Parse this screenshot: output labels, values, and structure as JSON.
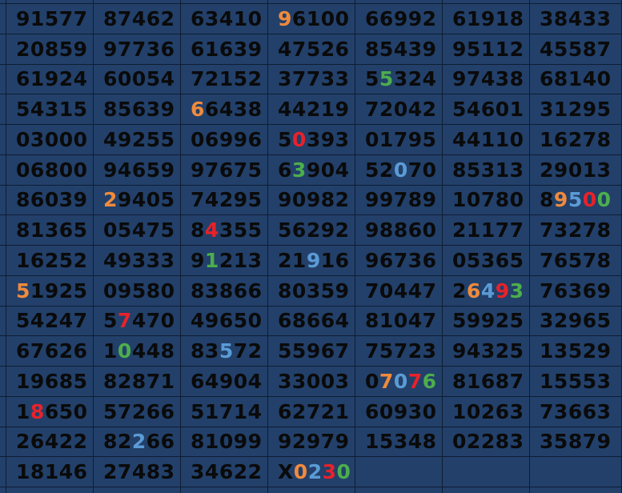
{
  "colors": {
    "background": "#22406a",
    "grid_line": "#0f1d33",
    "text": "#0a0a0a",
    "orange": "#f08a3c",
    "green": "#4cae4c",
    "red": "#e8222a",
    "blue": "#5b9bd5"
  },
  "rows": [
    [
      {
        "text": "91577"
      },
      {
        "text": "87462"
      },
      {
        "text": "63410"
      },
      {
        "text": "96100",
        "hl": {
          "0": "orange"
        }
      },
      {
        "text": "66992"
      },
      {
        "text": "61918"
      },
      {
        "text": "38433"
      }
    ],
    [
      {
        "text": "20859"
      },
      {
        "text": "97736"
      },
      {
        "text": "61639"
      },
      {
        "text": "47526"
      },
      {
        "text": "85439"
      },
      {
        "text": "95112"
      },
      {
        "text": "45587"
      }
    ],
    [
      {
        "text": "61924"
      },
      {
        "text": "60054"
      },
      {
        "text": "72152"
      },
      {
        "text": "37733"
      },
      {
        "text": "55324",
        "hl": {
          "1": "green"
        }
      },
      {
        "text": "97438"
      },
      {
        "text": "68140"
      }
    ],
    [
      {
        "text": "54315"
      },
      {
        "text": "85639"
      },
      {
        "text": "66438",
        "hl": {
          "0": "orange"
        }
      },
      {
        "text": "44219"
      },
      {
        "text": "72042"
      },
      {
        "text": "54601"
      },
      {
        "text": "31295"
      }
    ],
    [
      {
        "text": "03000"
      },
      {
        "text": "49255"
      },
      {
        "text": "06996"
      },
      {
        "text": "50393",
        "hl": {
          "1": "red"
        }
      },
      {
        "text": "01795"
      },
      {
        "text": "44110"
      },
      {
        "text": "16278"
      }
    ],
    [
      {
        "text": "06800"
      },
      {
        "text": "94659"
      },
      {
        "text": "97675"
      },
      {
        "text": "63904",
        "hl": {
          "1": "green"
        }
      },
      {
        "text": "52070",
        "hl": {
          "2": "blue"
        }
      },
      {
        "text": "85313"
      },
      {
        "text": "29013"
      }
    ],
    [
      {
        "text": "86039"
      },
      {
        "text": "29405",
        "hl": {
          "0": "orange"
        }
      },
      {
        "text": "74295"
      },
      {
        "text": "90982"
      },
      {
        "text": "99789"
      },
      {
        "text": "10780"
      },
      {
        "text": "89500",
        "hl": {
          "1": "orange",
          "2": "blue",
          "3": "red",
          "4": "green"
        }
      }
    ],
    [
      {
        "text": "81365"
      },
      {
        "text": "05475"
      },
      {
        "text": "84355",
        "hl": {
          "1": "red"
        }
      },
      {
        "text": "56292"
      },
      {
        "text": "98860"
      },
      {
        "text": "21177"
      },
      {
        "text": "73278"
      }
    ],
    [
      {
        "text": "16252"
      },
      {
        "text": "49333"
      },
      {
        "text": "91213",
        "hl": {
          "1": "green"
        }
      },
      {
        "text": "21916",
        "hl": {
          "2": "blue"
        }
      },
      {
        "text": "96736"
      },
      {
        "text": "05365"
      },
      {
        "text": "76578"
      }
    ],
    [
      {
        "text": "51925",
        "hl": {
          "0": "orange"
        }
      },
      {
        "text": "09580"
      },
      {
        "text": "83866"
      },
      {
        "text": "80359"
      },
      {
        "text": "70447"
      },
      {
        "text": "26493",
        "hl": {
          "1": "orange",
          "2": "blue",
          "3": "red",
          "4": "green"
        }
      },
      {
        "text": "76369"
      }
    ],
    [
      {
        "text": "54247"
      },
      {
        "text": "57470",
        "hl": {
          "1": "red"
        }
      },
      {
        "text": "49650"
      },
      {
        "text": "68664"
      },
      {
        "text": "81047"
      },
      {
        "text": "59925"
      },
      {
        "text": "32965"
      }
    ],
    [
      {
        "text": "67626"
      },
      {
        "text": "10448",
        "hl": {
          "1": "green"
        }
      },
      {
        "text": "83572",
        "hl": {
          "2": "blue"
        }
      },
      {
        "text": "55967"
      },
      {
        "text": "75723"
      },
      {
        "text": "94325"
      },
      {
        "text": "13529"
      }
    ],
    [
      {
        "text": "19685"
      },
      {
        "text": "82871"
      },
      {
        "text": "64904"
      },
      {
        "text": "33003"
      },
      {
        "text": "07076",
        "hl": {
          "1": "orange",
          "2": "blue",
          "3": "red",
          "4": "green"
        }
      },
      {
        "text": "81687"
      },
      {
        "text": "15553"
      }
    ],
    [
      {
        "text": "18650",
        "hl": {
          "1": "red"
        }
      },
      {
        "text": "57266"
      },
      {
        "text": "51714"
      },
      {
        "text": "62721"
      },
      {
        "text": "60930"
      },
      {
        "text": "10263"
      },
      {
        "text": "73663"
      }
    ],
    [
      {
        "text": "26422"
      },
      {
        "text": "82266",
        "hl": {
          "2": "blue"
        }
      },
      {
        "text": "81099"
      },
      {
        "text": "92979"
      },
      {
        "text": "15348"
      },
      {
        "text": "02283"
      },
      {
        "text": "35879"
      }
    ],
    [
      {
        "text": "18146"
      },
      {
        "text": "27483"
      },
      {
        "text": "34622"
      },
      {
        "text": "X0230",
        "hl": {
          "1": "orange",
          "2": "blue",
          "3": "red",
          "4": "green"
        }
      },
      {
        "text": ""
      },
      {
        "text": ""
      },
      {
        "text": ""
      }
    ]
  ]
}
